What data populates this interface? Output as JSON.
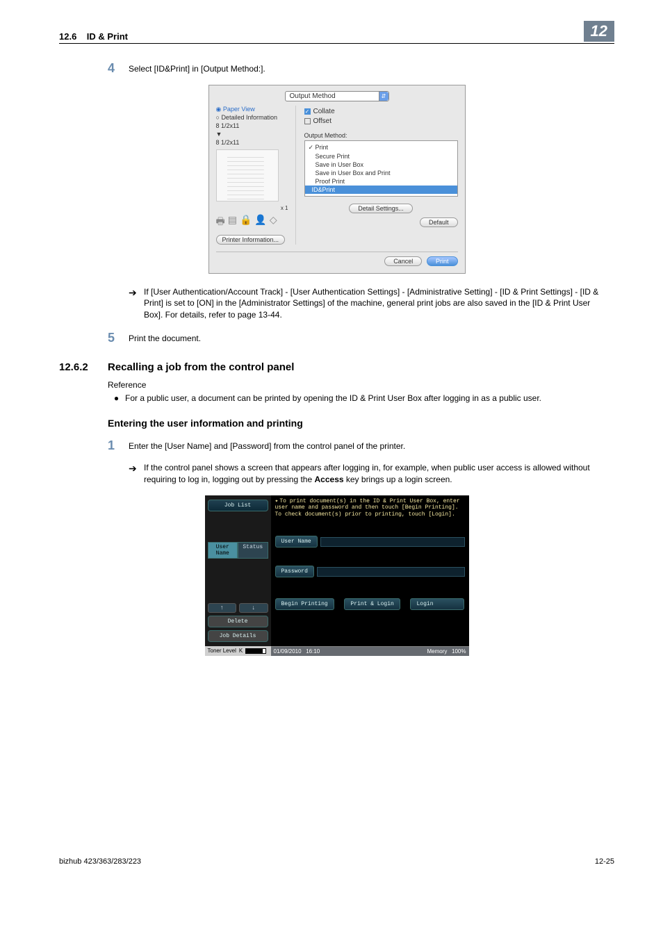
{
  "header": {
    "section_num": "12.6",
    "section_title": "ID & Print",
    "chapter": "12"
  },
  "step4": {
    "num": "4",
    "text": "Select [ID&Print] in [Output Method:]."
  },
  "mac": {
    "tab_title": "Output Method",
    "radio_paper": "Paper View",
    "radio_detail": "Detailed Information",
    "size": "8 1/2x11",
    "size_orient": "▼",
    "x1": "x 1",
    "printer_info": "Printer Information...",
    "collate": "Collate",
    "offset": "Offset",
    "om_label": "Output Method:",
    "om_items": [
      "Print",
      "Secure Print",
      "Save in User Box",
      "Save in User Box and Print",
      "Proof Print",
      "ID&Print"
    ],
    "detail_settings": "Detail Settings...",
    "default": "Default",
    "cancel": "Cancel",
    "print": "Print"
  },
  "note4": "If [User Authentication/Account Track] - [User Authentication Settings] - [Administrative Setting] - [ID & Print Settings] - [ID & Print] is set to [ON] in the [Administrator Settings] of the machine, general print jobs are also saved in the [ID & Print User Box]. For details, refer to page 13-44.",
  "step5": {
    "num": "5",
    "text": "Print the document."
  },
  "sec1262": {
    "num": "12.6.2",
    "title": "Recalling a job from the control panel"
  },
  "reference_label": "Reference",
  "public_note": "For a public user, a document can be printed by opening the ID & Print User Box after logging in as a public user.",
  "subheading": "Entering the user information and printing",
  "step1": {
    "num": "1",
    "text": "Enter the [User Name] and [Password] from the control panel of the printer."
  },
  "note1": {
    "pre": "If the control panel shows a screen that appears after logging in, for example, when public user access is allowed without requiring to log in, logging out by pressing the ",
    "bold": "Access",
    "post": " key brings up a login screen."
  },
  "panel": {
    "job_list": "Job List",
    "hint": "To print document(s) in the ID & Print User Box, enter user name and password and then touch [Begin Printing]. To check document(s) prior to printing, touch [Login].",
    "tab_user": "User Name",
    "tab_status": "Status",
    "user_name_label": "User Name",
    "password_label": "Password",
    "arrow_up": "↑",
    "arrow_down": "↓",
    "delete": "Delete",
    "job_details": "Job Details",
    "begin": "Begin Printing",
    "printlogin": "Print & Login",
    "login": "Login",
    "toner_level": "Toner Level",
    "toner_k": "K",
    "date": "01/09/2010",
    "time": "16:10",
    "memory": "Memory",
    "mempct": "100%"
  },
  "footer": {
    "left": "bizhub 423/363/283/223",
    "right": "12-25"
  }
}
